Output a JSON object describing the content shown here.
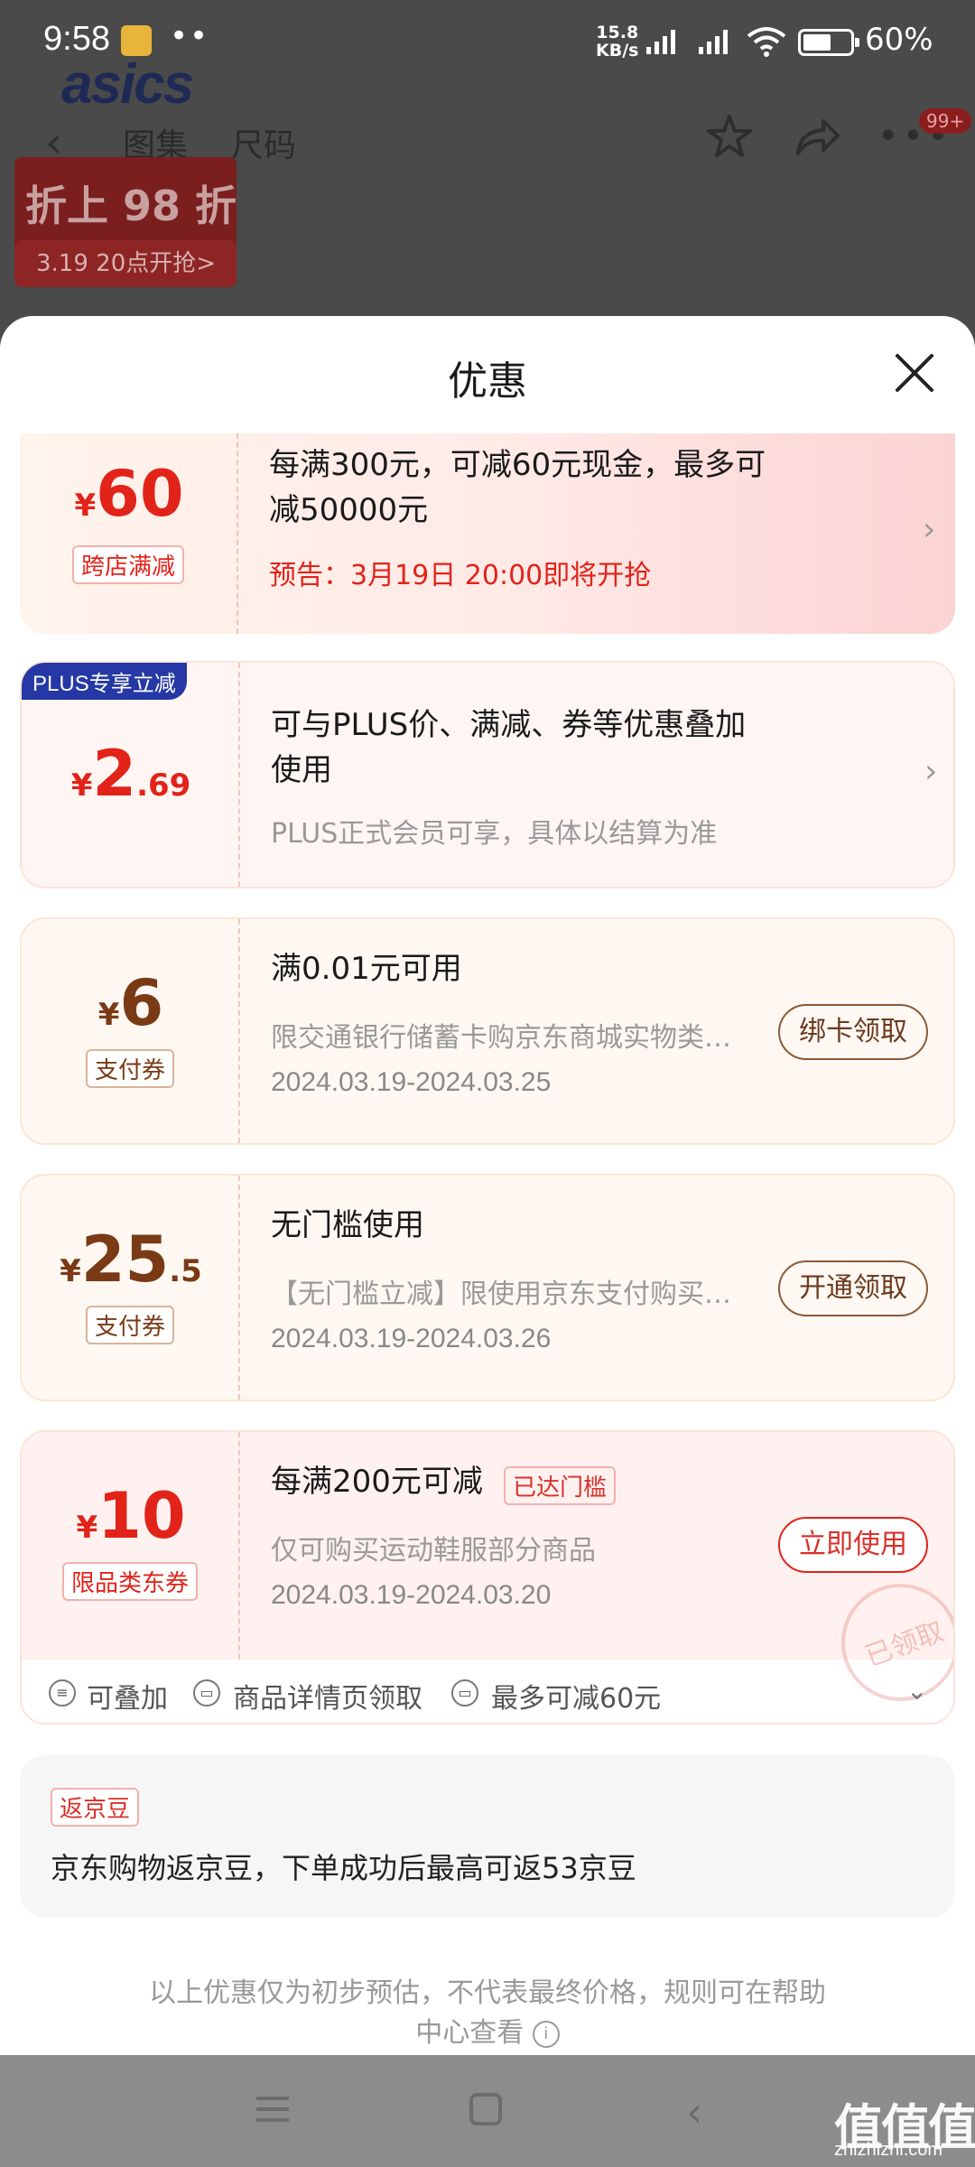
{
  "status_bar": {
    "time": "9:58",
    "dots": "••",
    "speed_value": "15.8",
    "speed_unit": "KB/s",
    "battery": "60%"
  },
  "product_page": {
    "brand": "asics",
    "tabs": [
      "图集",
      "尺码"
    ],
    "badge": "99+",
    "promo_main": "折上 98 折",
    "promo_sub": "3.19 20点开抢>"
  },
  "sheet": {
    "title": "优惠",
    "coupons": [
      {
        "currency": "¥",
        "amount_int": "60",
        "amount_dec": "",
        "tag": "跨店满减",
        "title_line1": "每满300元，可减60元现金，最多可",
        "title_line2": "减50000元",
        "notice": "预告：3月19日 20:00即将开抢"
      },
      {
        "badge": "PLUS专享立减",
        "currency": "¥",
        "amount_int": "2",
        "amount_dec": ".69",
        "title_line1": "可与PLUS价、满减、券等优惠叠加",
        "title_line2": "使用",
        "desc": "PLUS正式会员可享，具体以结算为准"
      },
      {
        "currency": "¥",
        "amount_int": "6",
        "amount_dec": "",
        "tag": "支付券",
        "title": "满0.01元可用",
        "desc": "限交通银行储蓄卡购京东商城实物类…",
        "date": "2024.03.19-2024.03.25",
        "button": "绑卡领取"
      },
      {
        "currency": "¥",
        "amount_int": "25",
        "amount_dec": ".5",
        "tag": "支付券",
        "title": "无门槛使用",
        "desc": "【无门槛立减】限使用京东支付购买…",
        "date": "2024.03.19-2024.03.26",
        "button": "开通领取"
      },
      {
        "currency": "¥",
        "amount_int": "10",
        "amount_dec": "",
        "tag": "限品类东券",
        "title": "每满200元可减",
        "reached_tag": "已达门槛",
        "desc": "仅可购买运动鞋服部分商品",
        "date": "2024.03.19-2024.03.20",
        "button": "立即使用",
        "stamp": "已领取",
        "features": [
          "可叠加",
          "商品详情页领取",
          "最多可减60元"
        ]
      }
    ],
    "bean": {
      "tag": "返京豆",
      "text": "京东购物返京豆，下单成功后最高可返53京豆"
    },
    "disclaimer_line1": "以上优惠仅为初步预估，不代表最终价格，规则可在帮助",
    "disclaimer_line2": "中心查看"
  },
  "watermark": {
    "main": "值值值",
    "sub": "zhizhizhi.com"
  },
  "colors": {
    "accent_red": "#e2231a",
    "brown": "#7a3a16",
    "plus_blue": "#2538a5"
  }
}
